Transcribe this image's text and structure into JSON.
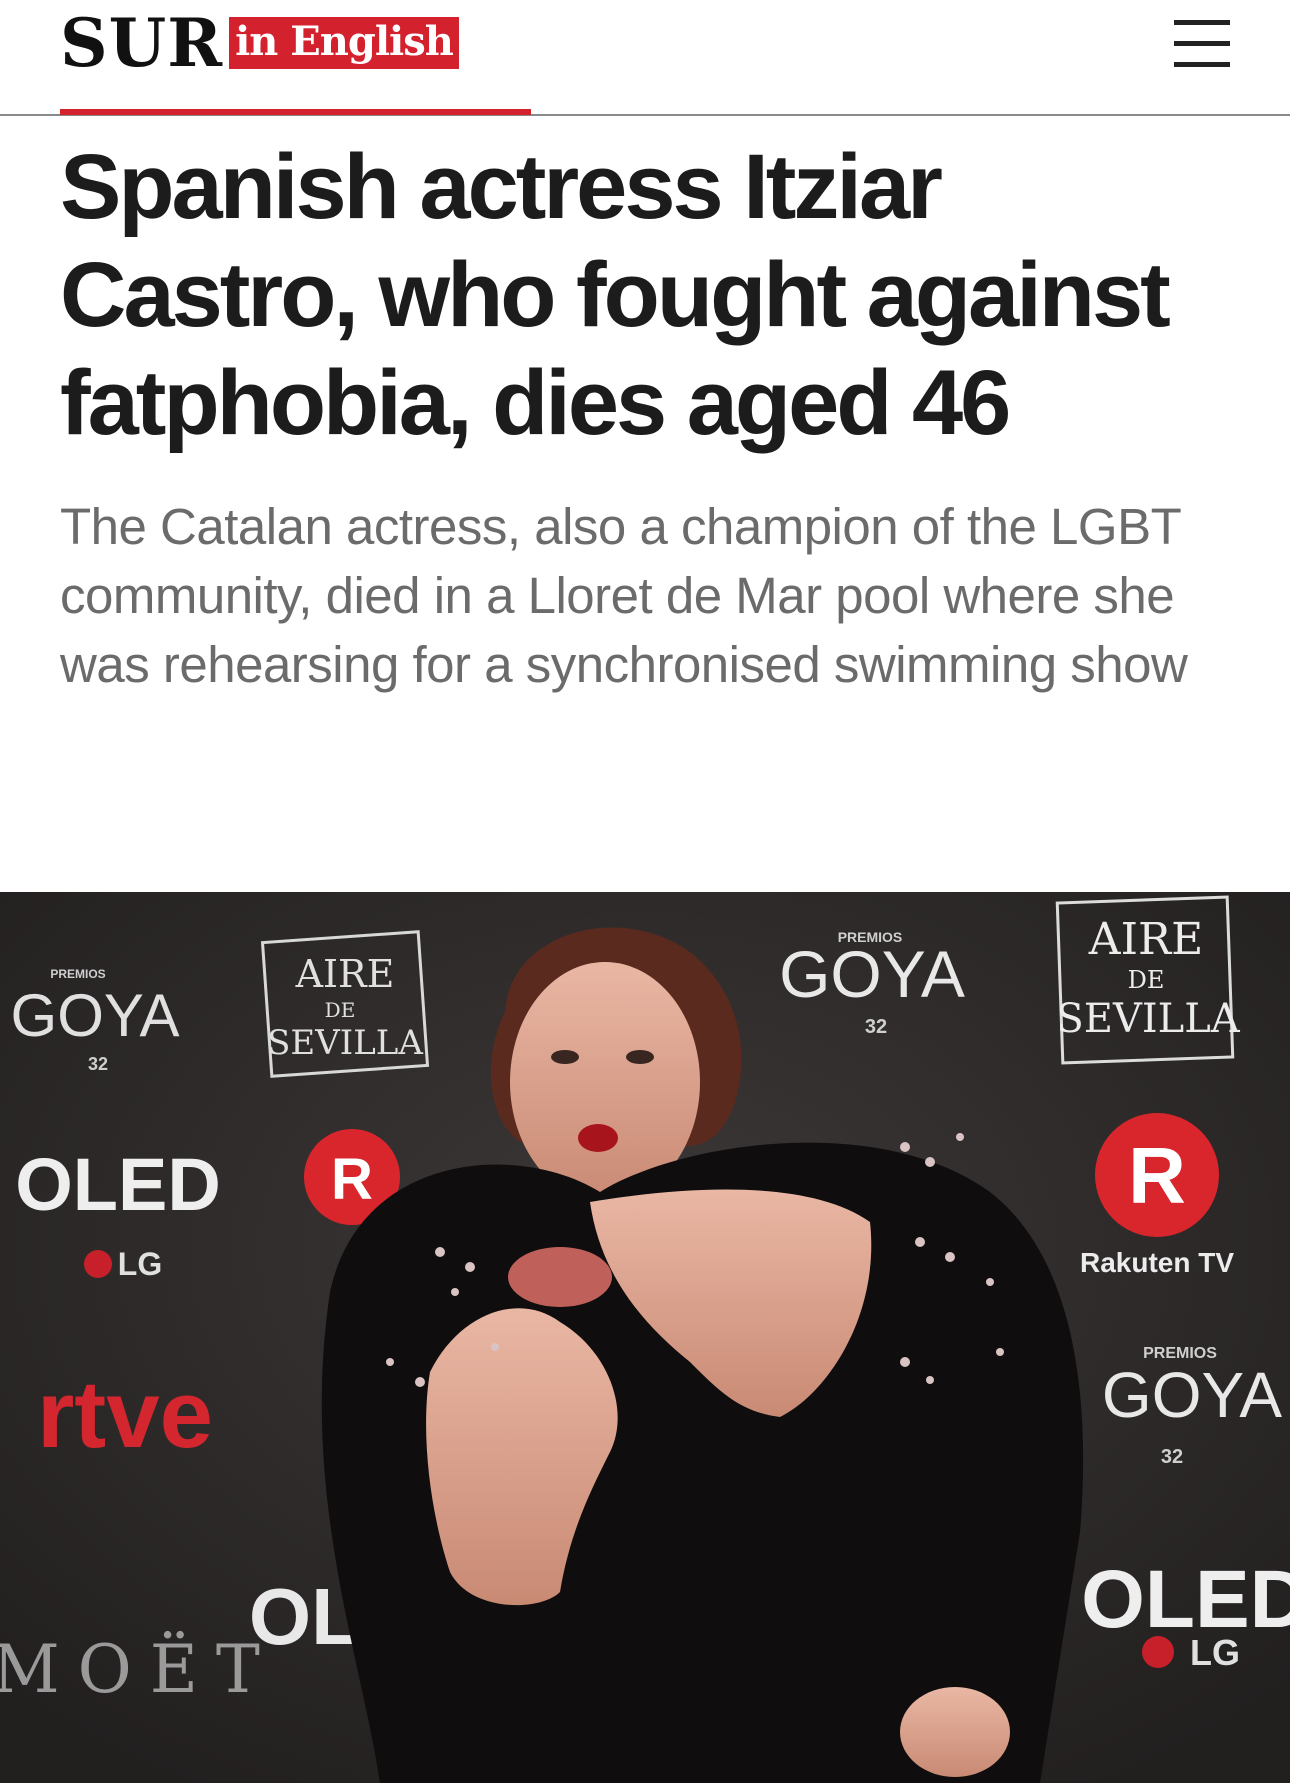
{
  "header": {
    "logo_main": "SUR",
    "logo_badge": "in English",
    "menu_icon": "hamburger-menu-icon"
  },
  "article": {
    "headline": "Spanish actress Itziar Castro, who fought against fatphobia, dies aged 46",
    "subheadline": "The Catalan actress, also a champion of the LGBT community, died in a Lloret de Mar pool where she was rehearsing for a synchronised swimming show"
  },
  "photo": {
    "backdrop_text": {
      "premios": "PREMIOS",
      "goya": "GOYA",
      "goya_num": "32",
      "aire": "AIRE",
      "de": "DE",
      "sevilla": "SEVILLA",
      "oled": "OLED",
      "lg": "LG",
      "rakuten": "Rakuten TV",
      "r_letter": "R",
      "rtve": "rtve",
      "moet": "MOËT"
    }
  },
  "colors": {
    "brand_red": "#d3212e",
    "headline": "#1c1c1c",
    "subheadline": "#6b6b6b",
    "backdrop": "#2e2a2a"
  }
}
